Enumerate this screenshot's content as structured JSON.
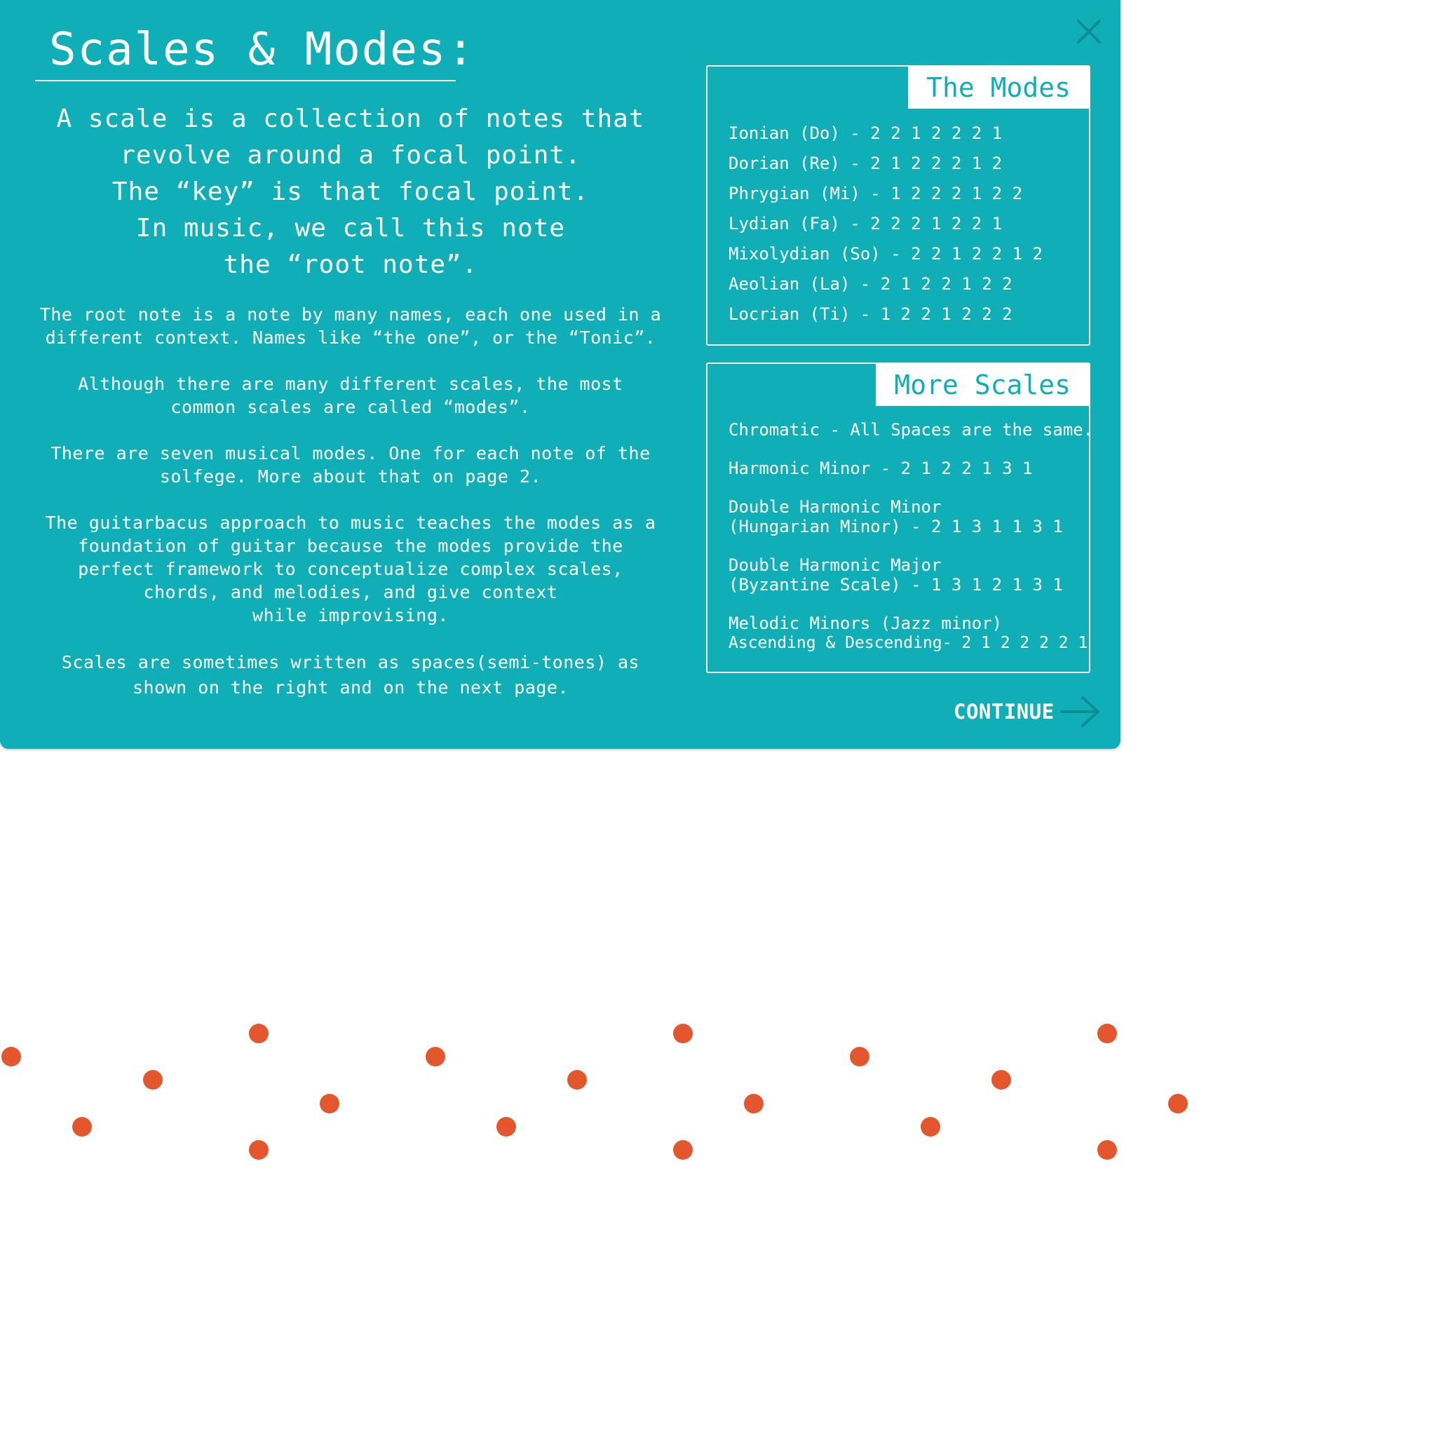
{
  "modal": {
    "title": "Scales & Modes:",
    "intro": [
      "A scale is a collection of notes that",
      "revolve around a focal point.",
      "The “key” is that focal point.",
      "In music, we call this note",
      "the “root note”."
    ],
    "paragraphs": [
      [
        "The root note is a note by many names, each one used in a",
        "different context. Names like “the one”, or the “Tonic”."
      ],
      [
        "Although there are many different scales, the most",
        "common scales are called “modes”."
      ],
      [
        "There are seven musical modes. One for each note of the",
        "solfege. More about that on page 2."
      ],
      [
        "The guitarbacus approach to music teaches the modes as a",
        "foundation of guitar because the modes provide the",
        "perfect framework to conceptualize complex scales,",
        "chords, and melodies, and give context",
        "while improvising."
      ],
      [
        "Scales are sometimes written as spaces(semi-tones) as",
        "shown on the right and on the next page."
      ]
    ],
    "close_icon": "close-icon",
    "continue_label": "CONTINUE",
    "continue_icon": "arrow-right-icon"
  },
  "modes_panel": {
    "title": "The Modes",
    "items": [
      "Ionian (Do) - 2 2 1 2 2 2 1",
      "Dorian (Re) - 2 1 2 2 2 1 2",
      "Phrygian (Mi) - 1 2 2 2 1 2 2",
      "Lydian (Fa) - 2 2 2 1 2 2 1",
      "Mixolydian (So) - 2 2 1 2 2 1 2",
      "Aeolian (La) - 2 1 2 2 1 2 2",
      "Locrian (Ti) - 1 2 2 1 2 2 2"
    ]
  },
  "more_panel": {
    "title": "More Scales",
    "items": [
      [
        "Chromatic - All Spaces are the same."
      ],
      [
        "Harmonic Minor - 2 1 2 2 1 3 1"
      ],
      [
        "Double Harmonic Minor",
        "(Hungarian Minor) - 2 1 3 1 1 3 1"
      ],
      [
        "Double Harmonic Major",
        "(Byzantine Scale) - 1 3 1 2 1 3 1"
      ],
      [
        "Melodic Minors (Jazz minor)",
        "Ascending & Descending- 2 1 2 2 2 2 1"
      ]
    ]
  },
  "colors": {
    "modal_bg": "#10aeb7",
    "text": "#ffffff",
    "close_icon": "#0b8d95",
    "dot": "#e4572e"
  },
  "background_decoration": {
    "dot_count": 24
  }
}
